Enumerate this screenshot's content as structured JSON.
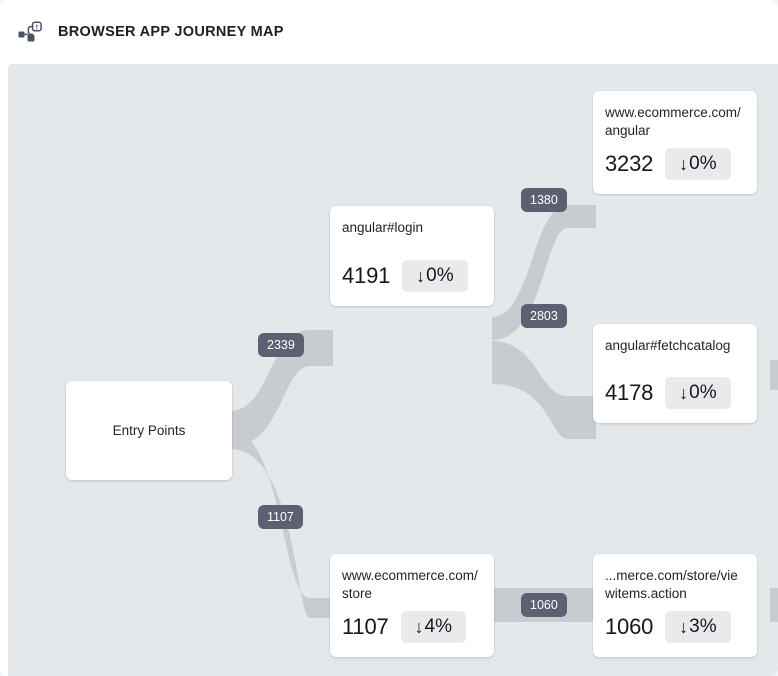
{
  "header": {
    "title": "BROWSER APP JOURNEY MAP",
    "icon": "journey-map-icon"
  },
  "colors": {
    "canvas_background": "#e4e8ea",
    "panel_background": "#ffffff",
    "edge_ribbon": "#c8ccd0",
    "edge_label_background": "#5b6170",
    "edge_label_text": "#ffffff",
    "node_background": "#ffffff",
    "node_text": "#20252c",
    "delta_chip_background": "#e8eaec"
  },
  "chart_data": {
    "type": "sankey",
    "title": "BROWSER APP JOURNEY MAP",
    "nodes": [
      {
        "id": "entry",
        "label": "Entry Points",
        "value": null,
        "delta": null,
        "delta_direction": null
      },
      {
        "id": "login",
        "label": "angular#login",
        "value": "4191",
        "delta": "0%",
        "delta_direction": "down"
      },
      {
        "id": "angular_page",
        "label": "www.ecommerce.com/angular",
        "value": "3232",
        "delta": "0%",
        "delta_direction": "down"
      },
      {
        "id": "fetchcatalog",
        "label": "angular#fetchcatalog",
        "value": "4178",
        "delta": "0%",
        "delta_direction": "down"
      },
      {
        "id": "store",
        "label": "www.ecommerce.com/store",
        "value": "1107",
        "delta": "4%",
        "delta_direction": "down"
      },
      {
        "id": "viewitems",
        "label": "...merce.com/store/viewitems.action",
        "value": "1060",
        "delta": "3%",
        "delta_direction": "down"
      }
    ],
    "links": [
      {
        "source": "entry",
        "target": "login",
        "value": 2339,
        "label": "2339"
      },
      {
        "source": "entry",
        "target": "store",
        "value": 1107,
        "label": "1107"
      },
      {
        "source": "login",
        "target": "angular_page",
        "value": 1380,
        "label": "1380"
      },
      {
        "source": "login",
        "target": "fetchcatalog",
        "value": 2803,
        "label": "2803"
      },
      {
        "source": "store",
        "target": "viewitems",
        "value": 1060,
        "label": "1060"
      }
    ]
  },
  "nodes": {
    "entry": {
      "label": "Entry Points"
    },
    "login": {
      "label": "angular#login",
      "value": "4191",
      "arrow": "↓",
      "delta": "0%"
    },
    "angular_page": {
      "label": "www.ecommerce.com/angular",
      "value": "3232",
      "arrow": "↓",
      "delta": "0%"
    },
    "fetchcatalog": {
      "label": "angular#fetchcatalog",
      "value": "4178",
      "arrow": "↓",
      "delta": "0%"
    },
    "store": {
      "label": "www.ecommerce.com/store",
      "value": "1107",
      "arrow": "↓",
      "delta": "4%"
    },
    "viewitems": {
      "label": "...merce.com/store/viewitems.action",
      "value": "1060",
      "arrow": "↓",
      "delta": "3%"
    }
  },
  "edge_labels": {
    "entry_login": "2339",
    "entry_store": "1107",
    "login_angular": "1380",
    "login_fetchcatalog": "2803",
    "store_viewitems": "1060"
  }
}
